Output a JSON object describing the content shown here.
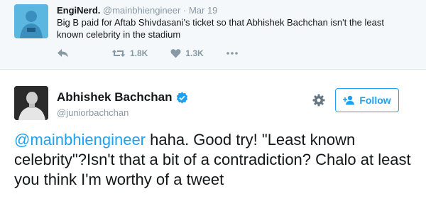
{
  "parent_tweet": {
    "name": "EngiNerd.",
    "handle": "@mainbhiengineer",
    "separator": "·",
    "time": "Mar 19",
    "text": "Big B paid for Aftab Shivdasani's ticket so that Abhishek Bachchan isn't the least known celebrity in the stadium",
    "actions": {
      "reply_icon": "reply-icon",
      "retweet_icon": "retweet-icon",
      "retweet_count": "1.8K",
      "like_icon": "heart-icon",
      "like_count": "1.3K",
      "more_icon": "more-icon"
    }
  },
  "main_tweet": {
    "name": "Abhishek Bachchan",
    "verified_icon": "verified-badge-icon",
    "handle": "@juniorbachchan",
    "gear_icon": "gear-icon",
    "follow_label": "Follow",
    "mention": "@mainbhiengineer",
    "text": " haha. Good try! \"Least known celebrity\"?Isn't that a bit of a contradiction? Chalo at least you think I'm worthy of a tweet"
  },
  "colors": {
    "link_blue": "#1da1f2",
    "muted_gray": "#8899a6",
    "parent_background": "#f5f8fa",
    "parent_avatar": "#5bb6e0"
  }
}
